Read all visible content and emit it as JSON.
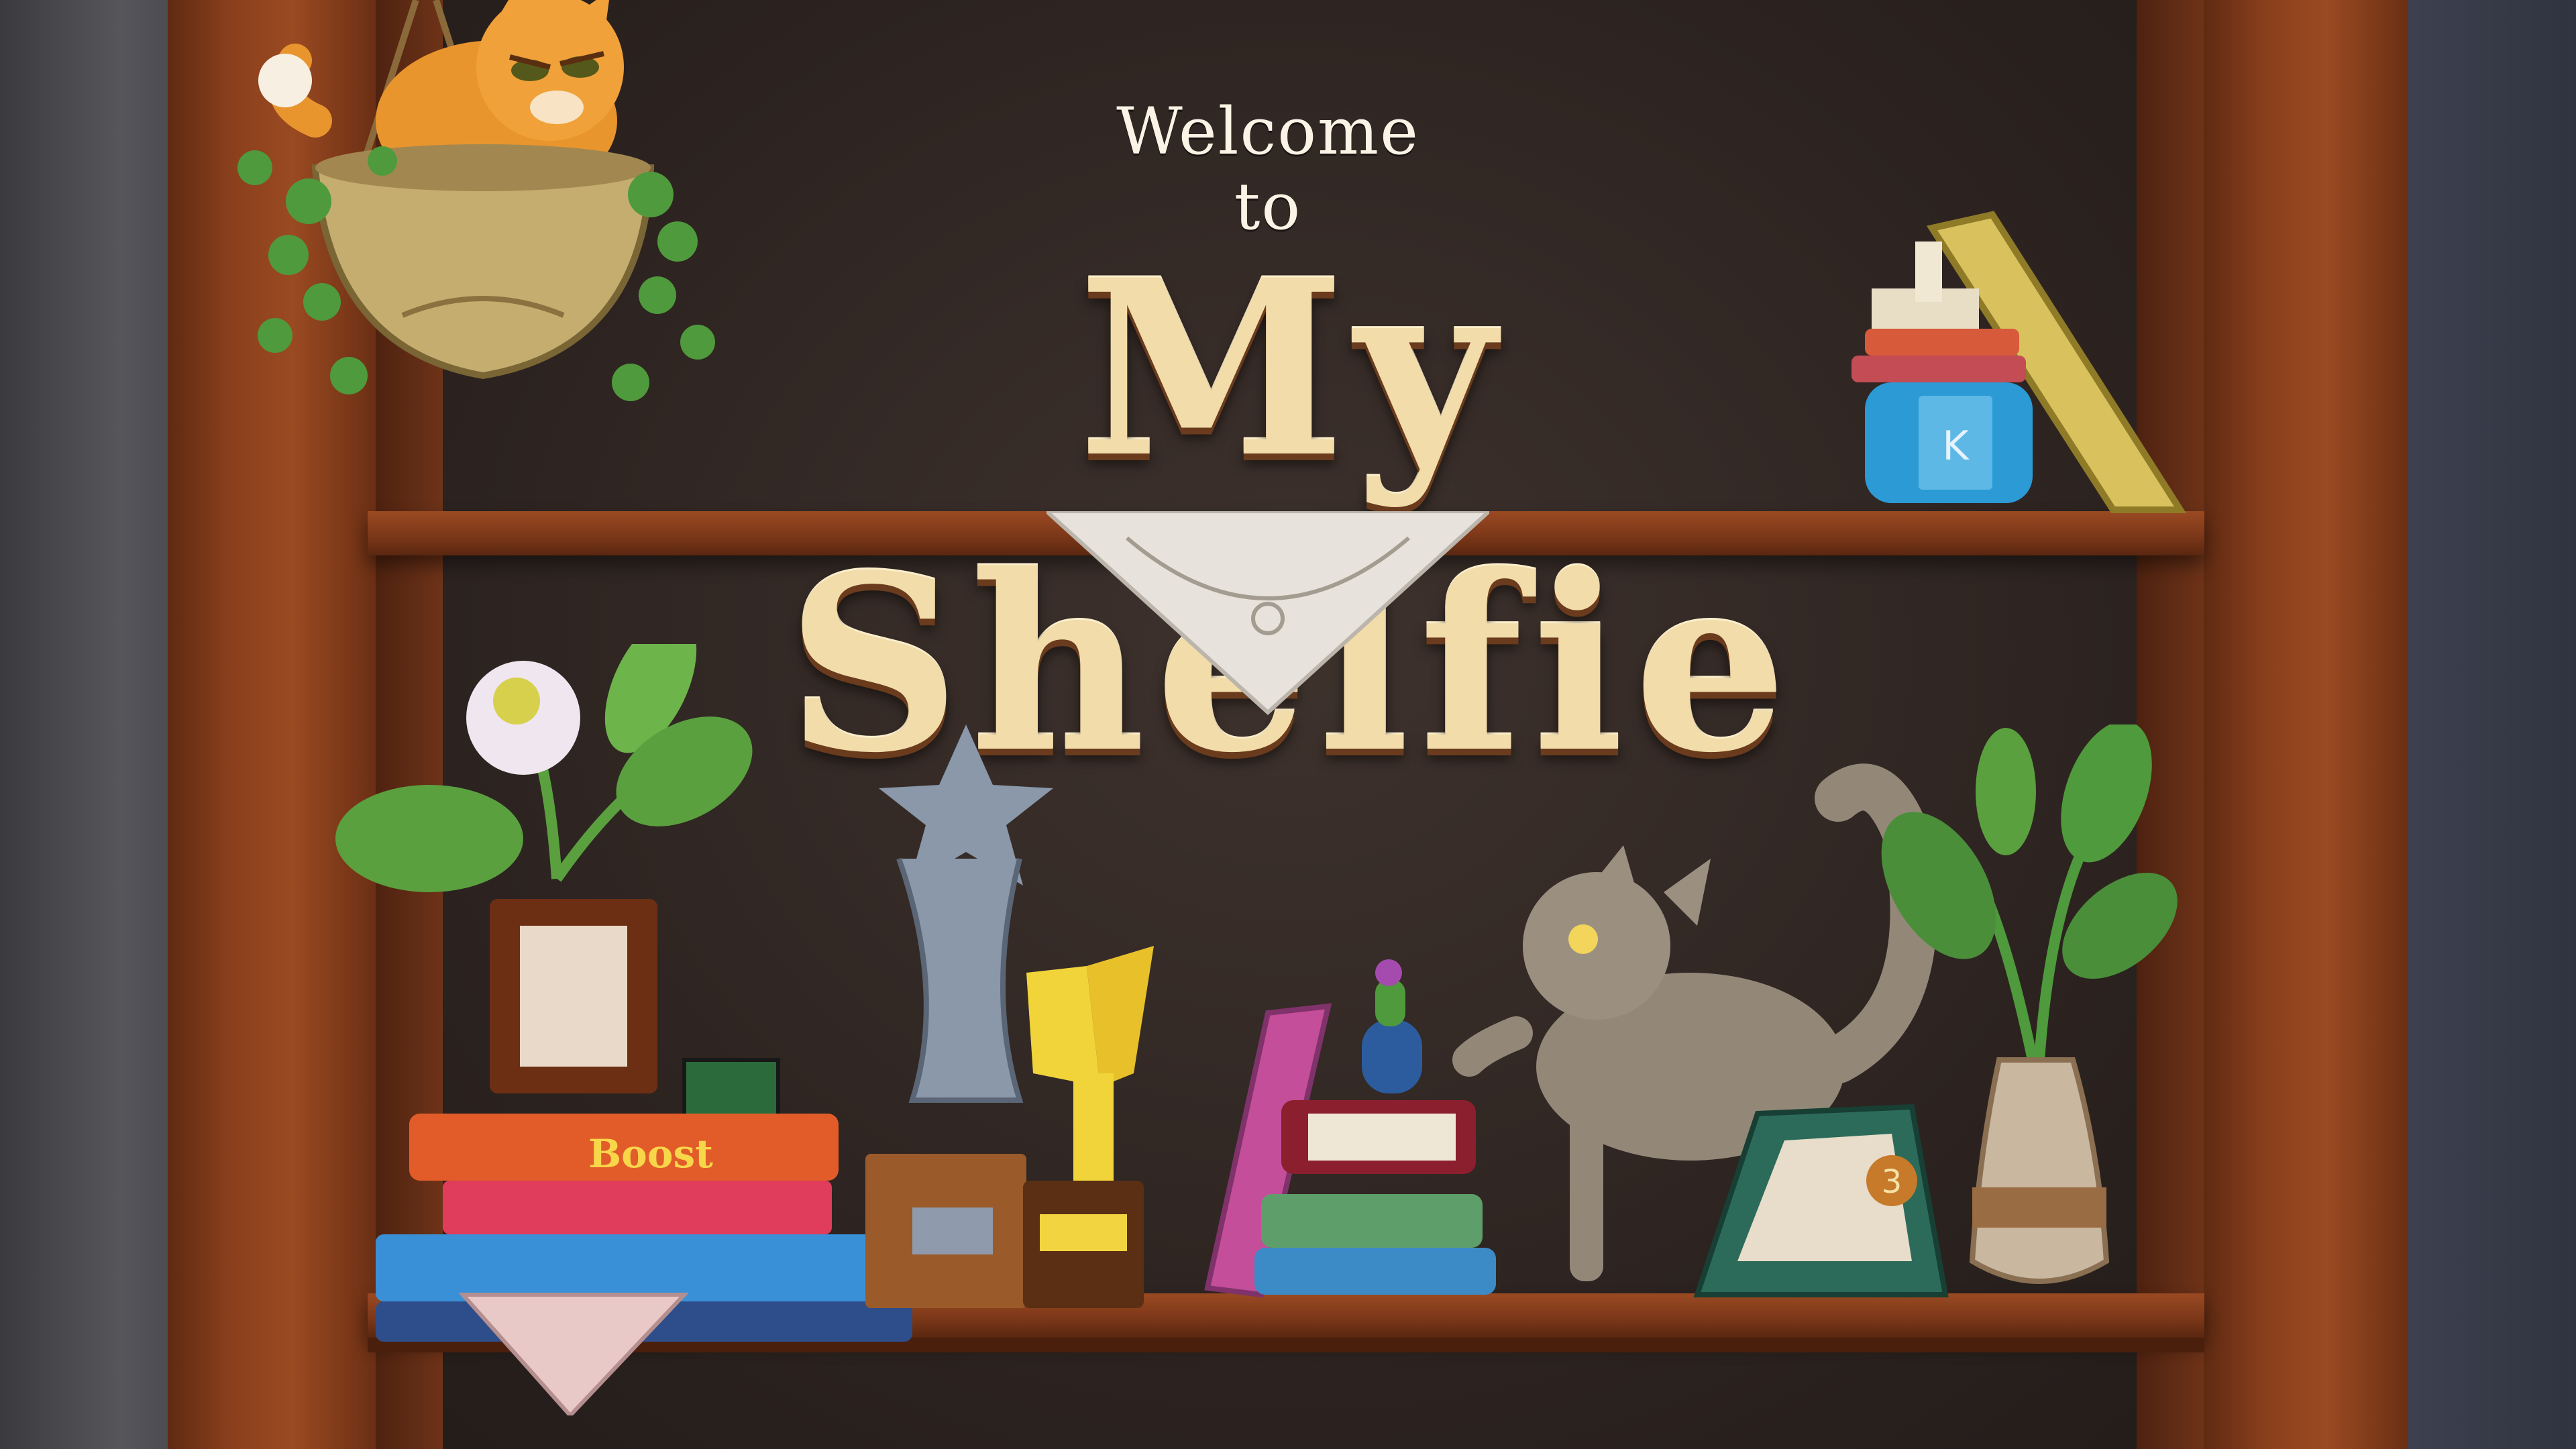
{
  "welcome_text": "Welcome to",
  "title": "My Shelfie",
  "box_label": "Boost",
  "medal_number": "3",
  "icons": {
    "top_book_spine": "K"
  }
}
